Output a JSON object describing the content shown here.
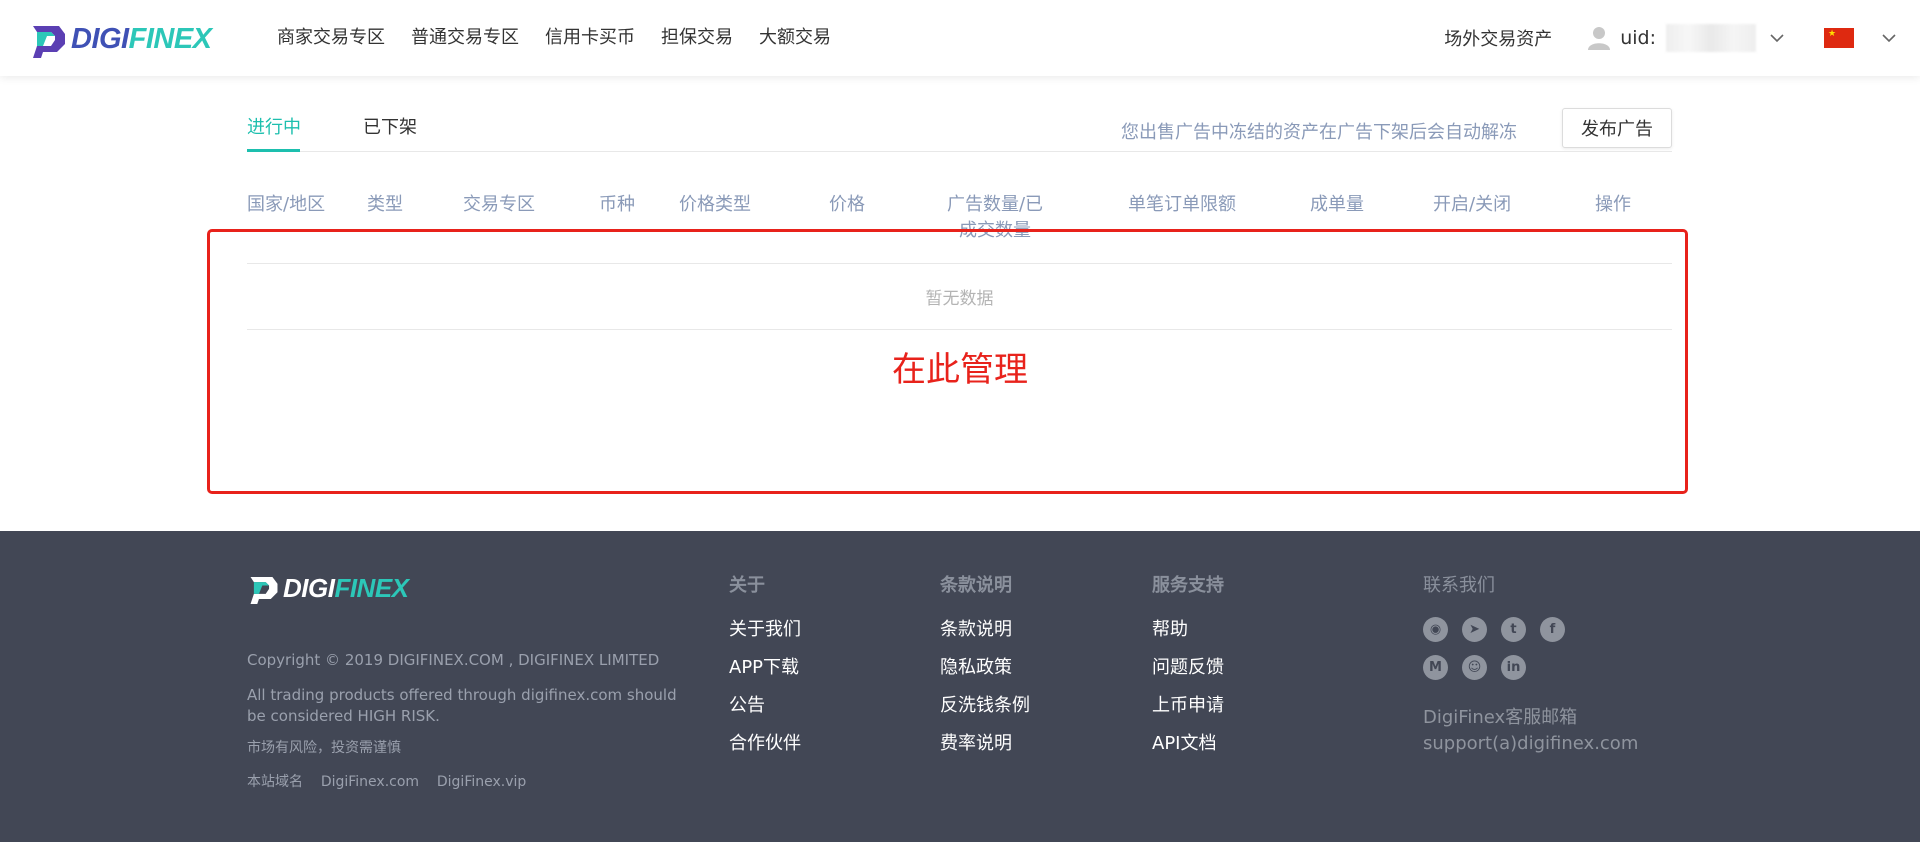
{
  "header": {
    "logo": {
      "part1": "DIGI",
      "part2": "FINEX"
    },
    "nav": [
      "商家交易专区",
      "普通交易专区",
      "信用卡买币",
      "担保交易",
      "大额交易"
    ],
    "otc_assets": "场外交易资产",
    "uid_label": "uid:",
    "language": "中国"
  },
  "tabs": {
    "active": "进行中",
    "inactive": "已下架"
  },
  "notice": "您出售广告中冻结的资产在广告下架后会自动解冻",
  "publish_button": "发布广告",
  "table": {
    "columns": [
      "国家/地区",
      "类型",
      "交易专区",
      "币种",
      "价格类型",
      "价格",
      "广告数量/已成交数量",
      "单笔订单限额",
      "成单量",
      "开启/关闭",
      "操作"
    ],
    "empty_text": "暂无数据"
  },
  "annotation": {
    "text": "在此管理",
    "color": "#e8221b"
  },
  "footer": {
    "logo": {
      "part1": "DIGI",
      "part2": "FINEX"
    },
    "copyright": "Copyright © 2019 DIGIFINEX.COM , DIGIFINEX LIMITED",
    "risk_en": "All trading products offered through digifinex.com should be considered HIGH RISK.",
    "risk_cn": "市场有风险，投资需谨慎",
    "domains_label": "本站域名",
    "domain1": "DigiFinex.com",
    "domain2": "DigiFinex.vip",
    "about": {
      "title": "关于",
      "links": [
        "关于我们",
        "APP下载",
        "公告",
        "合作伙伴"
      ]
    },
    "terms": {
      "title": "条款说明",
      "links": [
        "条款说明",
        "隐私政策",
        "反洗钱条例",
        "费率说明"
      ]
    },
    "support": {
      "title": "服务支持",
      "links": [
        "帮助",
        "问题反馈",
        "上币申请",
        "API文档"
      ]
    },
    "contact": {
      "title": "联系我们",
      "icons": [
        "wechat-icon",
        "telegram-icon",
        "twitter-icon",
        "facebook-icon",
        "medium-icon",
        "reddit-icon",
        "linkedin-icon"
      ],
      "mail_label": "DigiFinex客服邮箱",
      "mail": "support(a)digifinex.com"
    }
  },
  "colors": {
    "accent": "#1dbfae",
    "brand_blue": "#3f51b5",
    "footer_bg": "#424755"
  }
}
